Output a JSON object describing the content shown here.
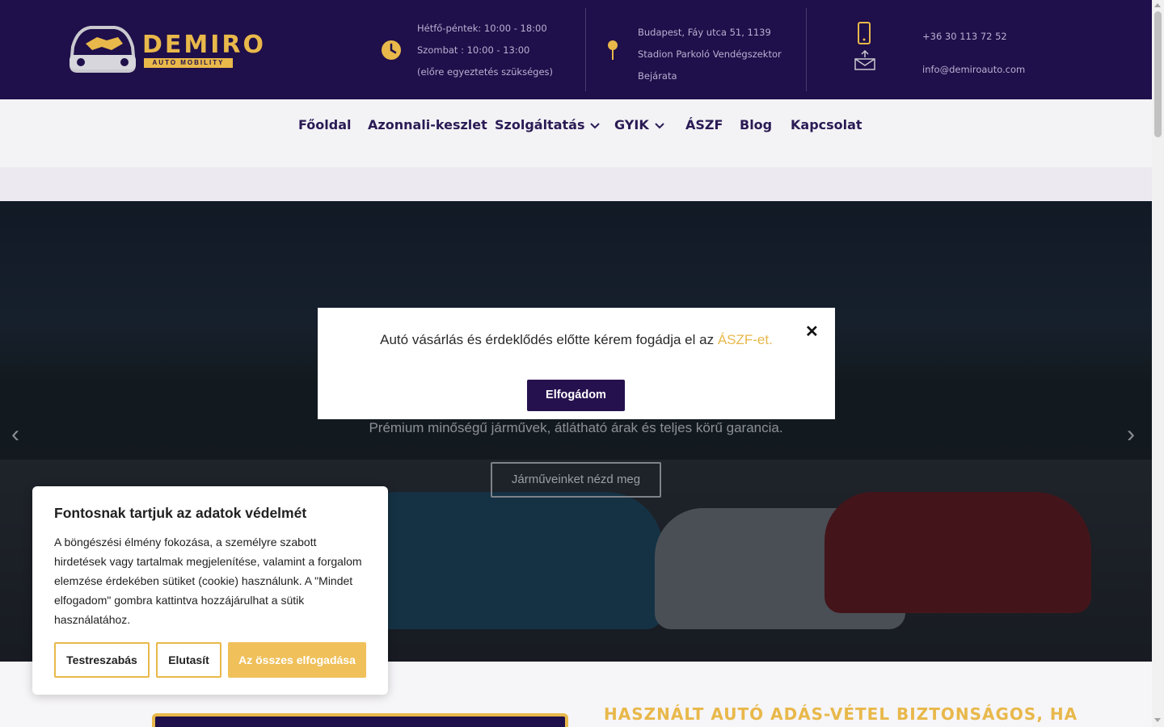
{
  "header": {
    "logo": {
      "name": "DEMIRO",
      "tagline": "AUTO MOBILITY"
    },
    "hours": {
      "line1": "Hétfő-péntek: 10:00 - 18:00",
      "line2": "Szombat : 10:00 - 13:00",
      "line3": "(előre egyeztetés szükséges)"
    },
    "address": {
      "line1": "Budapest, Fáy utca 51, 1139",
      "line2": "Stadion Parkoló Vendégszektor",
      "line3": "Bejárata"
    },
    "contact": {
      "phone": "+36 30 113 72 52",
      "email": "info@demiroauto.com"
    },
    "colors": {
      "brand_dark": "#1f0f4a",
      "accent_gold": "#e8b84a"
    },
    "icons": {
      "hours": "clock-icon",
      "address": "map-pin-icon",
      "phone": "smartphone-icon",
      "email": "envelope-icon"
    }
  },
  "nav": {
    "items": [
      {
        "label": "Főoldal"
      },
      {
        "label": "Azonnali-keszlet"
      },
      {
        "label": "Szolgáltatás"
      },
      {
        "label": "GYIK"
      },
      {
        "label": "ÁSZF"
      },
      {
        "label": "Blog"
      },
      {
        "label": "Kapcsolat"
      }
    ]
  },
  "hero": {
    "subtitle": "Prémium minőségű járművek, átlátható árak és teljes körű garancia.",
    "cta": "Járműveinket nézd meg",
    "prev_icon": "‹",
    "next_icon": "›"
  },
  "modal": {
    "text": "Autó vásárlás és érdeklődés előtte kérem fogádja el az ",
    "link": "ÁSZF-et.",
    "close": "✕",
    "button": "Elfogádom"
  },
  "cookie": {
    "title": "Fontosnak tartjuk az adatok védelmét",
    "body": "A böngészési élmény fokozása, a személyre szabott hirdetések vagy tartalmak megjelenítése, valamint a forgalom elemzése érdekében sütiket (cookie) használunk. A \"Mindet elfogadom\" gombra kattintva hozzájárulhat a sütik használatához.",
    "customize": "Testreszabás",
    "reject": "Elutasít",
    "accept_all": "Az összes elfogadása"
  },
  "section": {
    "heading": "HASZNÁLT AUTÓ ADÁS-VÉTEL BIZTONSÁGOS, HA"
  }
}
